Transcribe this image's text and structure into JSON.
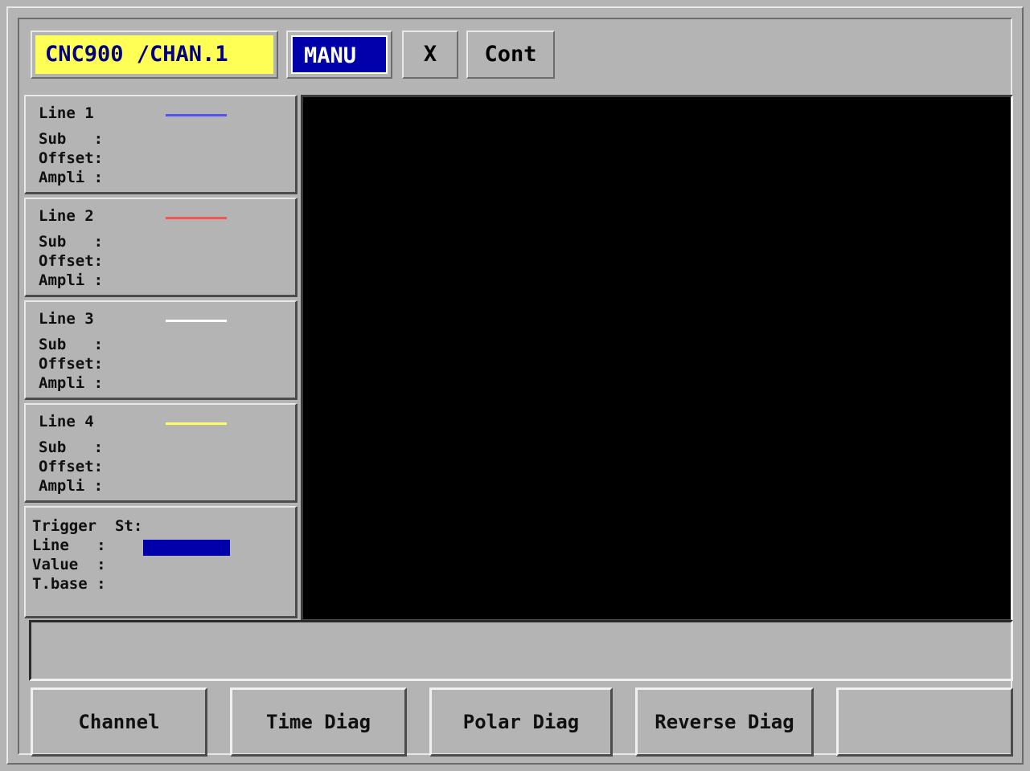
{
  "header": {
    "title": "CNC900 /CHAN.1",
    "mode": "MANU",
    "axis": "X",
    "cont": "Cont"
  },
  "lines": [
    {
      "title": "Line 1",
      "color": "#5050ff",
      "rows": [
        "Sub   :",
        "Offset:",
        "Ampli :"
      ]
    },
    {
      "title": "Line 2",
      "color": "#ff5050",
      "rows": [
        "Sub   :",
        "Offset:",
        "Ampli :"
      ]
    },
    {
      "title": "Line 3",
      "color": "#ffffff",
      "rows": [
        "Sub   :",
        "Offset:",
        "Ampli :"
      ]
    },
    {
      "title": "Line 4",
      "color": "#ffff55",
      "rows": [
        "Sub   :",
        "Offset:",
        "Ampli :"
      ]
    }
  ],
  "trigger": {
    "title": "Trigger  St:",
    "line": "Line   :",
    "value": "Value  :",
    "tbase": "T.base :",
    "line_color": "#0000aa"
  },
  "message": "",
  "softkeys": [
    "Channel",
    "Time Diag",
    "Polar Diag",
    "Reverse Diag",
    ""
  ],
  "colors": {
    "background": "#b4b4b4",
    "title_bg": "#ffff55",
    "mode_bg": "#0000aa",
    "scope_bg": "#000000"
  }
}
